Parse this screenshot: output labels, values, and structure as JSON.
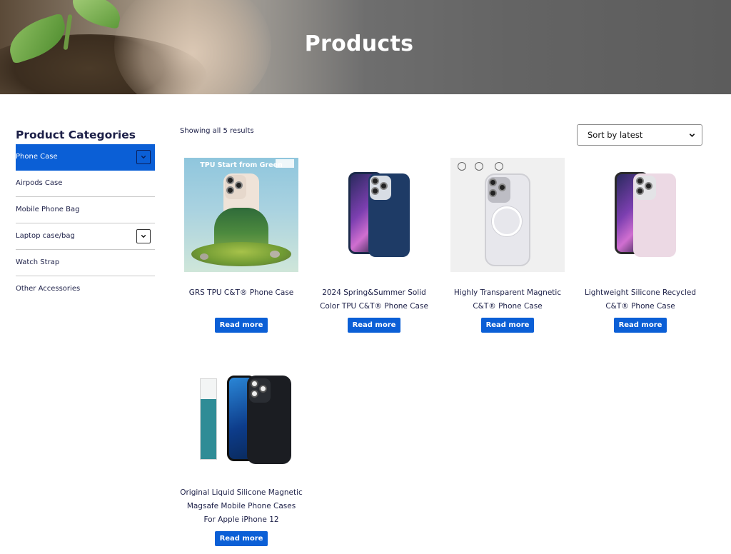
{
  "hero": {
    "title": "Products"
  },
  "sidebar": {
    "heading": "Product Categories",
    "items": [
      {
        "label": "Phone Case",
        "active": true,
        "has_children": true
      },
      {
        "label": "Airpods Case",
        "active": false,
        "has_children": false
      },
      {
        "label": "Mobile Phone Bag",
        "active": false,
        "has_children": false
      },
      {
        "label": "Laptop case/bag",
        "active": false,
        "has_children": true
      },
      {
        "label": "Watch Strap",
        "active": false,
        "has_children": false
      },
      {
        "label": "Other Accessories",
        "active": false,
        "has_children": false
      }
    ]
  },
  "results": {
    "count_text": "Showing all 5 results",
    "sort": {
      "selected": "Sort by latest"
    }
  },
  "products": [
    {
      "title_line1": "GRS TPU C&T® Phone Case",
      "title_line2": "",
      "title_line3": "",
      "button": "Read more",
      "image_caption": "TPU Start from Green"
    },
    {
      "title_line1": "2024 Spring&Summer Solid",
      "title_line2": "Color TPU C&T® Phone Case",
      "title_line3": "",
      "button": "Read more"
    },
    {
      "title_line1": "Highly Transparent Magnetic",
      "title_line2": "C&T® Phone Case",
      "title_line3": "",
      "button": "Read more"
    },
    {
      "title_line1": "Lightweight Silicone Recycled",
      "title_line2": "C&T® Phone Case",
      "title_line3": "",
      "button": "Read more"
    },
    {
      "title_line1": "Original Liquid Silicone Magnetic",
      "title_line2": "Magsafe Mobile Phone Cases",
      "title_line3": "For Apple iPhone 12",
      "button": "Read more"
    }
  ],
  "colors": {
    "accent": "#0b5fd6",
    "text": "#1d2048",
    "divider": "#c9c9c9"
  }
}
